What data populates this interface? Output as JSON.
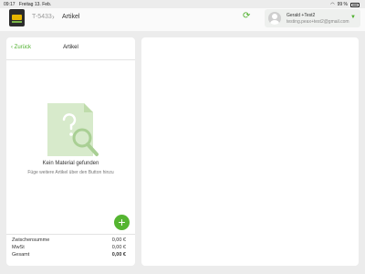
{
  "statusbar": {
    "time": "09:17",
    "date": "Freitag 13. Feb.",
    "battery": "99 %"
  },
  "navbar": {
    "breadcrumb_prev": "T-5433",
    "breadcrumb_current": "Artikel",
    "user_name": "Gerald +Test2",
    "user_email": "testing.peax+test2@gmail.com"
  },
  "left_panel": {
    "back_label": "Zurück",
    "title": "Artikel",
    "empty_title": "Kein Material gefunden",
    "empty_hint": "Füge weitere Artikel über den Button hinzu",
    "add_label": "+"
  },
  "summary": [
    {
      "label": "Zwischensumme",
      "value": "0,00 €"
    },
    {
      "label": "MwSt",
      "value": "0,00 €"
    },
    {
      "label": "Gesamt",
      "value": "0,00 €"
    }
  ],
  "colors": {
    "accent": "#55b531",
    "background": "#ececec",
    "panel": "#ffffff"
  }
}
